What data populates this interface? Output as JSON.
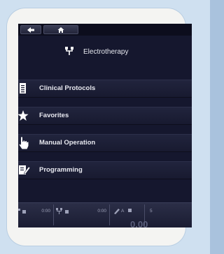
{
  "header": {
    "title": "Electrotherapy"
  },
  "menu": {
    "items": [
      {
        "label": "Clinical Protocols",
        "icon": "clipboard-icon"
      },
      {
        "label": "Favorites",
        "icon": "star-icon"
      },
      {
        "label": "Manual Operation",
        "icon": "hand-pointer-icon"
      },
      {
        "label": "Programming",
        "icon": "edit-icon"
      }
    ]
  },
  "status": {
    "seg1_time": "0:00",
    "seg2_time": "0:00",
    "seg3_mode": "A",
    "seg3_time": "5",
    "big_value": "0.00"
  },
  "colors": {
    "screen_bg": "#15172e",
    "menu_text": "#e8e9f0",
    "frame_bg": "#f4f4f2",
    "page_bg": "#cfe0f0"
  }
}
